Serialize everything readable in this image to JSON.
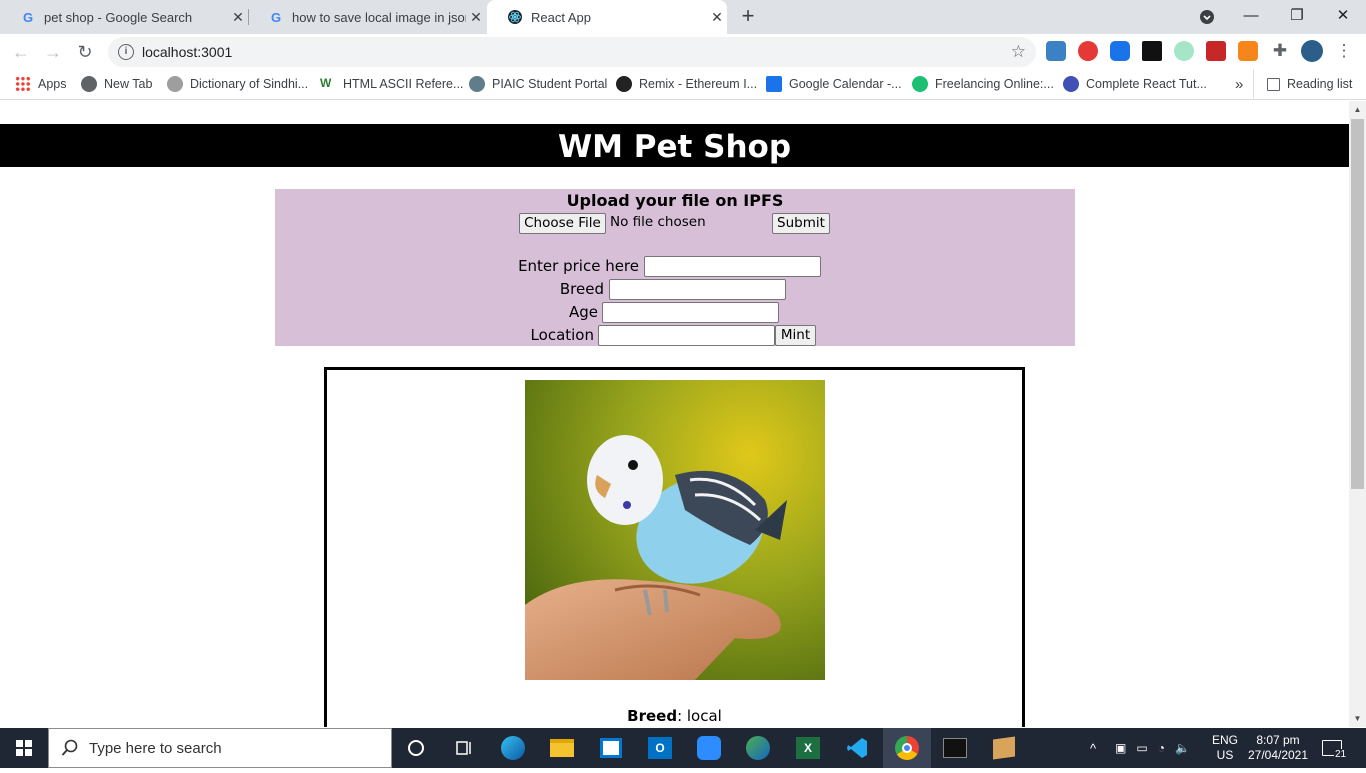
{
  "browser": {
    "tabs": [
      {
        "title": "pet shop - Google Search"
      },
      {
        "title": "how to save local image in json f"
      },
      {
        "title": "React App"
      }
    ],
    "url": "localhost:3001",
    "bookmarks": [
      {
        "label": "Apps"
      },
      {
        "label": "New Tab"
      },
      {
        "label": "Dictionary of Sindhi..."
      },
      {
        "label": "HTML ASCII Refere..."
      },
      {
        "label": "PIAIC Student Portal"
      },
      {
        "label": "Remix - Ethereum I..."
      },
      {
        "label": "Google Calendar -..."
      },
      {
        "label": "Freelancing Online:..."
      },
      {
        "label": "Complete React Tut..."
      }
    ],
    "more_bookmarks": "»",
    "reading_list": "Reading list"
  },
  "page": {
    "title": "WM Pet Shop",
    "upload": {
      "heading": "Upload your file on IPFS",
      "choose_file": "Choose File",
      "no_file": "No file chosen",
      "submit": "Submit",
      "price_label": "Enter price here",
      "breed_label": "Breed",
      "age_label": "Age",
      "location_label": "Location",
      "mint": "Mint"
    },
    "card": {
      "breed_label": "Breed",
      "breed_value": ": local"
    }
  },
  "taskbar": {
    "search_placeholder": "Type here to search",
    "lang": "ENG",
    "region": "US",
    "time": "8:07 pm",
    "date": "27/04/2021",
    "notifications": "21"
  }
}
